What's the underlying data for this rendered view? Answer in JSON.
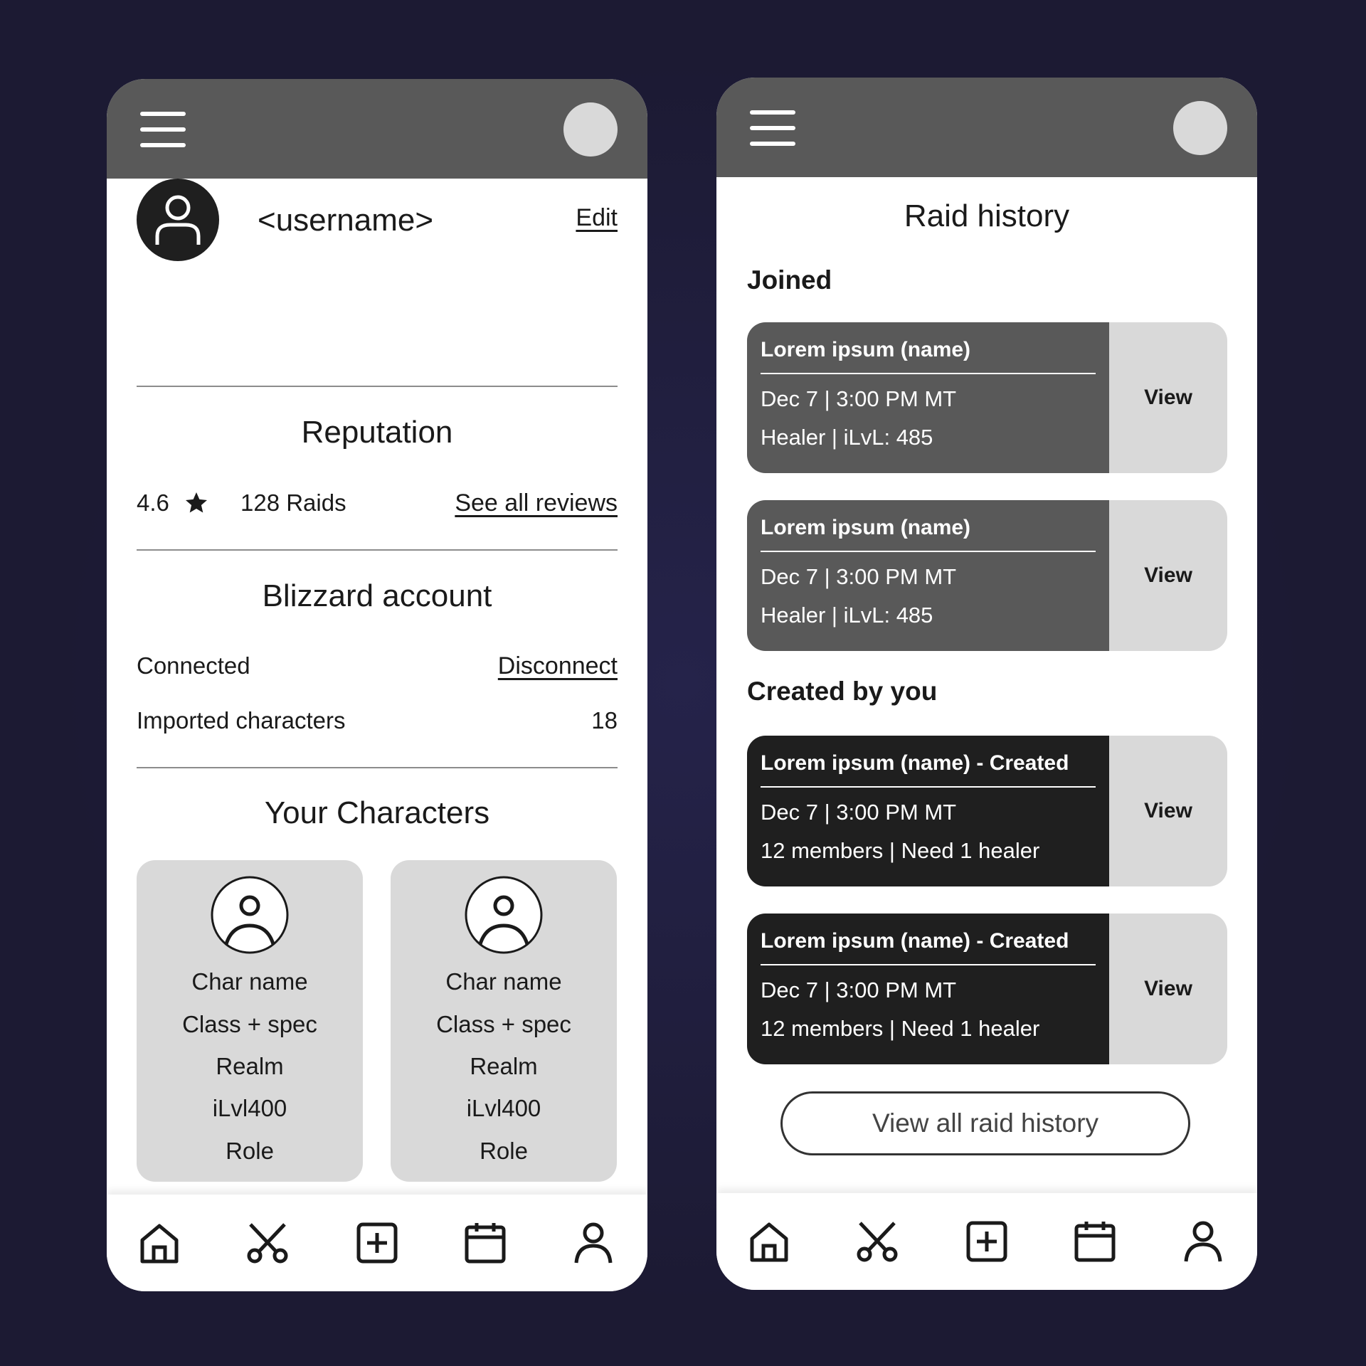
{
  "profile_screen": {
    "username": "<username>",
    "edit_label": "Edit",
    "reputation": {
      "title": "Reputation",
      "rating": "4.6",
      "raids": "128 Raids",
      "see_all_label": "See all reviews"
    },
    "blizzard": {
      "title": "Blizzard account",
      "status": "Connected",
      "disconnect_label": "Disconnect",
      "imported_label": "Imported characters",
      "imported_count": "18"
    },
    "characters": {
      "title": "Your Characters",
      "cards": [
        {
          "name": "Char name",
          "class_spec": "Class + spec",
          "realm": "Realm",
          "ilvl": "iLvl400",
          "role": "Role"
        },
        {
          "name": "Char name",
          "class_spec": "Class + spec",
          "realm": "Realm",
          "ilvl": "iLvl400",
          "role": "Role"
        }
      ]
    }
  },
  "raid_screen": {
    "title": "Raid history",
    "joined_heading": "Joined",
    "created_heading": "Created by you",
    "joined": [
      {
        "name": "Lorem ipsum (name)",
        "when": "Dec 7 | 3:00 PM MT",
        "detail": "Healer | iLvL: 485",
        "view": "View"
      },
      {
        "name": "Lorem ipsum (name)",
        "when": "Dec 7 | 3:00 PM MT",
        "detail": "Healer | iLvL: 485",
        "view": "View"
      }
    ],
    "created": [
      {
        "name": "Lorem ipsum (name) - Created",
        "when": "Dec 7 | 3:00 PM MT",
        "detail": "12 members | Need 1 healer",
        "view": "View"
      },
      {
        "name": "Lorem ipsum (name) - Created",
        "when": "Dec 7 | 3:00 PM MT",
        "detail": "12 members | Need 1 healer",
        "view": "View"
      }
    ],
    "view_all_label": "View all raid history"
  },
  "nav_icons": [
    "home-icon",
    "crossed-swords-icon",
    "add-square-icon",
    "calendar-icon",
    "profile-icon"
  ],
  "colors": {
    "background": "#1c1a33",
    "header": "#595959",
    "card_light": "#d9d9d9",
    "card_dark": "#1f1f1f",
    "card_mid": "#595959"
  }
}
